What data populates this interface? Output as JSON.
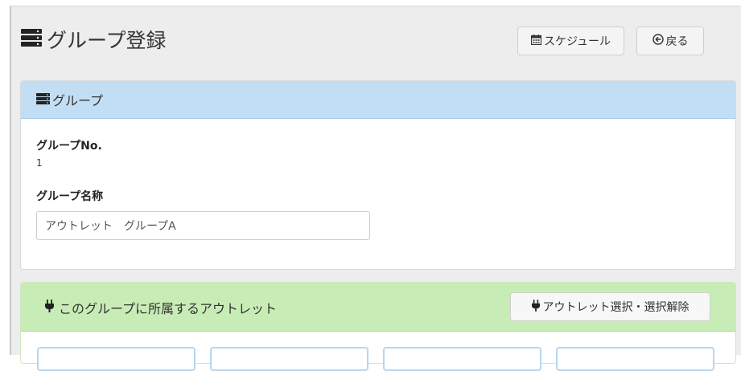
{
  "header": {
    "title": "グループ登録",
    "title_icon": "server-icon",
    "schedule_label": "スケジュール",
    "schedule_icon": "calendar-icon",
    "back_label": "戻る",
    "back_icon": "circle-arrow-left-icon"
  },
  "group_card": {
    "heading": "グループ",
    "heading_icon": "server-icon",
    "number_label": "グループNo.",
    "number_value": "1",
    "name_label": "グループ名称",
    "name_value": "アウトレット　グループA"
  },
  "outlet_card": {
    "heading": "このグループに所属するアウトレット",
    "heading_icon": "plug-icon",
    "select_button_label": "アウトレット選択・選択解除",
    "select_button_icon": "plug-icon"
  },
  "colors": {
    "group_header_bg": "#c2def5",
    "outlet_header_bg": "#c8ecb6",
    "page_bg": "#ededed"
  }
}
